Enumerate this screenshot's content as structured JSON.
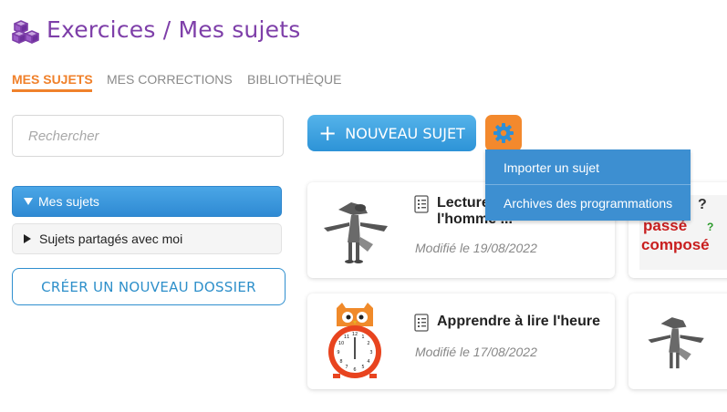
{
  "header": {
    "title": "Exercices / Mes sujets",
    "logo_icon": "cubes-icon",
    "brand_color": "#7e3fa9"
  },
  "tabs": [
    {
      "label": "MES SUJETS",
      "active": true
    },
    {
      "label": "MES CORRECTIONS",
      "active": false
    },
    {
      "label": "BIBLIOTHÈQUE",
      "active": false
    }
  ],
  "accent_color": "#f0812b",
  "search": {
    "placeholder": "Rechercher",
    "value": ""
  },
  "folders": [
    {
      "label": "Mes sujets",
      "expanded": true,
      "selected": true
    },
    {
      "label": "Sujets partagés avec moi",
      "expanded": false,
      "selected": false
    }
  ],
  "create_folder_label": "CRÉER UN NOUVEAU DOSSIER",
  "new_subject_label": "NOUVEAU SUJET",
  "settings_icon": "gear-icon",
  "menu": {
    "items": [
      "Importer un sujet",
      "Archives des programmations"
    ]
  },
  "cards": [
    {
      "title": "Lecture : l'homme ... Copi...",
      "date": "Modifié le 19/08/2022",
      "thumbnail": "wolf-illustration"
    },
    {
      "title": "Apprendre à lire l'heure",
      "date": "Modifié le 17/08/2022",
      "thumbnail": "owl-clock-illustration"
    }
  ],
  "partial_cards": [
    {
      "thumbnail": "passe-compose-image",
      "text_lines": [
        "passé",
        "composé"
      ]
    },
    {
      "thumbnail": "wolf-illustration"
    }
  ]
}
